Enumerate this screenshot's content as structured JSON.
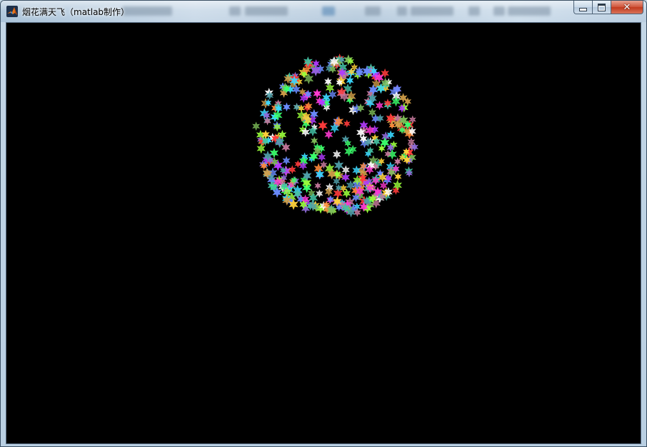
{
  "window": {
    "title": "烟花满天飞（matlab制作）",
    "background_color": "#000000",
    "caption_buttons": {
      "minimize_icon": "minimize-icon",
      "maximize_icon": "maximize-icon",
      "close_icon": "close-icon",
      "close_glyph": "✕"
    }
  },
  "firework": {
    "marker": "hexagram",
    "colors": [
      "#ff3b3b",
      "#ffd23b",
      "#3bff6b",
      "#3bd8ff",
      "#b33bff",
      "#ff3bd2",
      "#ffffff",
      "#ff8a3b",
      "#6b8cff",
      "#9aff3b",
      "#44c2a4",
      "#d5a14a",
      "#8e6bd8",
      "#4f9ea8",
      "#c77a9e",
      "#7fbf5a"
    ]
  }
}
